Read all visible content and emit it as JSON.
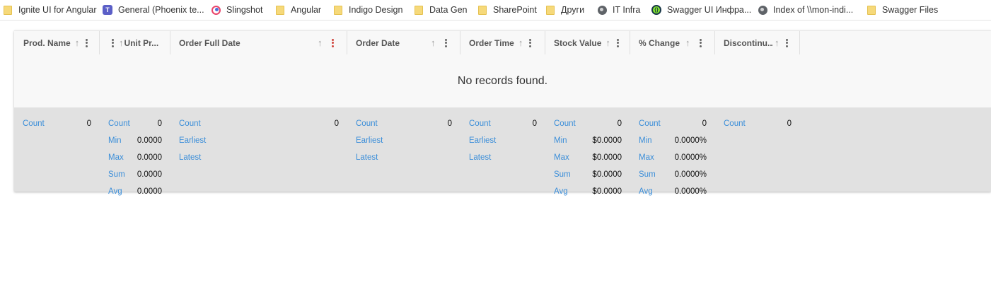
{
  "bookmarks": [
    {
      "label": "Ignite UI for Angular",
      "icon": "folder-icon"
    },
    {
      "label": "General (Phoenix te...",
      "icon": "teams-icon"
    },
    {
      "label": "Slingshot",
      "icon": "slingshot-icon"
    },
    {
      "label": "Angular",
      "icon": "folder-icon"
    },
    {
      "label": "Indigo Design",
      "icon": "folder-icon"
    },
    {
      "label": "Data Gen",
      "icon": "folder-icon"
    },
    {
      "label": "SharePoint",
      "icon": "folder-icon"
    },
    {
      "label": "Други",
      "icon": "folder-icon"
    },
    {
      "label": "IT Infra",
      "icon": "globe-icon"
    },
    {
      "label": "Swagger UI Инфра...",
      "icon": "swagger-icon"
    },
    {
      "label": "Index of \\\\mon-indi...",
      "icon": "globe-icon"
    },
    {
      "label": "Swagger Files",
      "icon": "folder-icon"
    }
  ],
  "grid": {
    "columns": [
      {
        "label": "Prod. Name"
      },
      {
        "label": "Unit Pr..."
      },
      {
        "label": "Order Full Date"
      },
      {
        "label": "Order Date"
      },
      {
        "label": "Order Time"
      },
      {
        "label": "Stock Value"
      },
      {
        "label": "% Change"
      },
      {
        "label": "Discontinu..."
      }
    ],
    "empty_message": "No records found.",
    "summaries": [
      [
        {
          "label": "Count",
          "value": "0"
        }
      ],
      [
        {
          "label": "Count",
          "value": "0"
        },
        {
          "label": "Min",
          "value": "0.0000"
        },
        {
          "label": "Max",
          "value": "0.0000"
        },
        {
          "label": "Sum",
          "value": "0.0000"
        },
        {
          "label": "Avg",
          "value": "0.0000"
        }
      ],
      [
        {
          "label": "Count",
          "value": "0"
        },
        {
          "label": "Earliest",
          "value": ""
        },
        {
          "label": "Latest",
          "value": ""
        }
      ],
      [
        {
          "label": "Count",
          "value": "0"
        },
        {
          "label": "Earliest",
          "value": ""
        },
        {
          "label": "Latest",
          "value": ""
        }
      ],
      [
        {
          "label": "Count",
          "value": "0"
        },
        {
          "label": "Earliest",
          "value": ""
        },
        {
          "label": "Latest",
          "value": ""
        }
      ],
      [
        {
          "label": "Count",
          "value": "0"
        },
        {
          "label": "Min",
          "value": "$0.0000"
        },
        {
          "label": "Max",
          "value": "$0.0000"
        },
        {
          "label": "Sum",
          "value": "$0.0000"
        },
        {
          "label": "Avg",
          "value": "$0.0000"
        }
      ],
      [
        {
          "label": "Count",
          "value": "0"
        },
        {
          "label": "Min",
          "value": "0.0000%"
        },
        {
          "label": "Max",
          "value": "0.0000%"
        },
        {
          "label": "Sum",
          "value": "0.0000%"
        },
        {
          "label": "Avg",
          "value": "0.0000%"
        }
      ],
      [
        {
          "label": "Count",
          "value": "0"
        }
      ]
    ]
  }
}
